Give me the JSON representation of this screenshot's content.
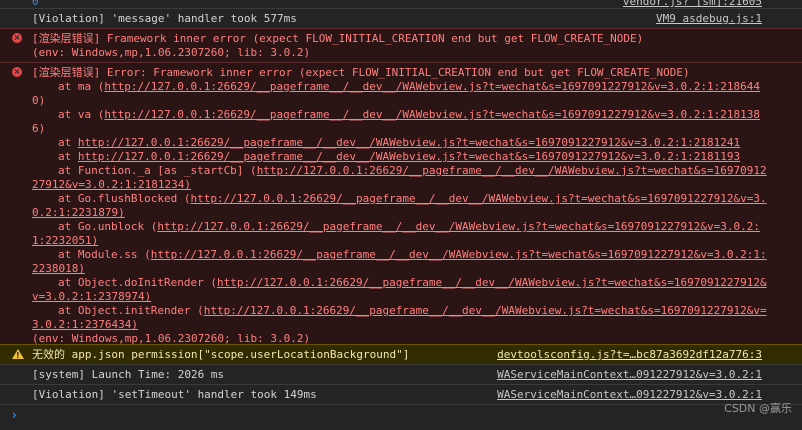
{
  "top_row": {
    "left": "0",
    "src": "vendor.js? [sm]:21605"
  },
  "rows": [
    {
      "type": "log",
      "text": "[Violation] 'message' handler took 577ms",
      "src": "VM9 asdebug.js:1"
    },
    {
      "type": "error",
      "lines": [
        "[渲染层错误] Framework inner error (expect FLOW_INITIAL_CREATION end but get FLOW_CREATE_NODE)",
        "(env: Windows,mp,1.06.2307260; lib: 3.0.2)"
      ]
    },
    {
      "type": "error",
      "head": "[渲染层错误] Error: Framework inner error (expect FLOW_INITIAL_CREATION end but get FLOW_CREATE_NODE)",
      "stack": [
        {
          "pre": "at ma (",
          "url": "http://127.0.0.1:26629/__pageframe__/__dev__/WAWebview.js?t=wechat&s=1697091227912&v=3.0.2:1:218644",
          "wrap": "0)"
        },
        {
          "pre": "at va (",
          "url": "http://127.0.0.1:26629/__pageframe__/__dev__/WAWebview.js?t=wechat&s=1697091227912&v=3.0.2:1:218138",
          "wrap": "6)"
        },
        {
          "pre": "at ",
          "url": "http://127.0.0.1:26629/__pageframe__/__dev__/WAWebview.js?t=wechat&s=1697091227912&v=3.0.2:1:2181241",
          "wrap": ""
        },
        {
          "pre": "at ",
          "url": "http://127.0.0.1:26629/__pageframe__/__dev__/WAWebview.js?t=wechat&s=1697091227912&v=3.0.2:1:2181193",
          "wrap": ""
        },
        {
          "pre": "at Function._a [as _startCb] (",
          "url": "http://127.0.0.1:26629/__pageframe__/__dev__/WAWebview.js?t=wechat&s=16970912",
          "wrap": "27912&v=3.0.2:1:2181234)"
        },
        {
          "pre": "at Go.flushBlocked (",
          "url": "http://127.0.0.1:26629/__pageframe__/__dev__/WAWebview.js?t=wechat&s=1697091227912&v=3.",
          "wrap": "0.2:1:2231879)"
        },
        {
          "pre": "at Go.unblock (",
          "url": "http://127.0.0.1:26629/__pageframe__/__dev__/WAWebview.js?t=wechat&s=1697091227912&v=3.0.2:",
          "wrap": "1:2232051)"
        },
        {
          "pre": "at Module.ss (",
          "url": "http://127.0.0.1:26629/__pageframe__/__dev__/WAWebview.js?t=wechat&s=1697091227912&v=3.0.2:1:",
          "wrap": "2238018)"
        },
        {
          "pre": "at Object.doInitRender (",
          "url": "http://127.0.0.1:26629/__pageframe__/__dev__/WAWebview.js?t=wechat&s=1697091227912&",
          "wrap": "v=3.0.2:1:2378974)"
        },
        {
          "pre": "at Object.initRender (",
          "url": "http://127.0.0.1:26629/__pageframe__/__dev__/WAWebview.js?t=wechat&s=1697091227912&v=",
          "wrap": "3.0.2:1:2376434)"
        }
      ],
      "env": "(env: Windows,mp,1.06.2307260; lib: 3.0.2)"
    },
    {
      "type": "warning",
      "text": "无效的 app.json permission[\"scope.userLocationBackground\"]",
      "src": "devtoolsconfig.js?t=…bc87a3692df12a776:3"
    },
    {
      "type": "log",
      "text": "[system] Launch Time: 2026 ms",
      "src": "WAServiceMainContext…091227912&v=3.0.2:1"
    },
    {
      "type": "log",
      "text": "[Violation] 'setTimeout' handler took 149ms",
      "src": "WAServiceMainContext…091227912&v=3.0.2:1"
    }
  ],
  "prompt_glyph": "›",
  "watermark": "CSDN @赢乐",
  "colors": {
    "background": "#242424",
    "error_text": "#ff8080",
    "error_bg": "#2a1414",
    "warning_bg": "#332b00",
    "caret": "#4fa3ff"
  },
  "icons": {
    "error": "error-circle-icon",
    "warning": "warning-triangle-icon"
  }
}
